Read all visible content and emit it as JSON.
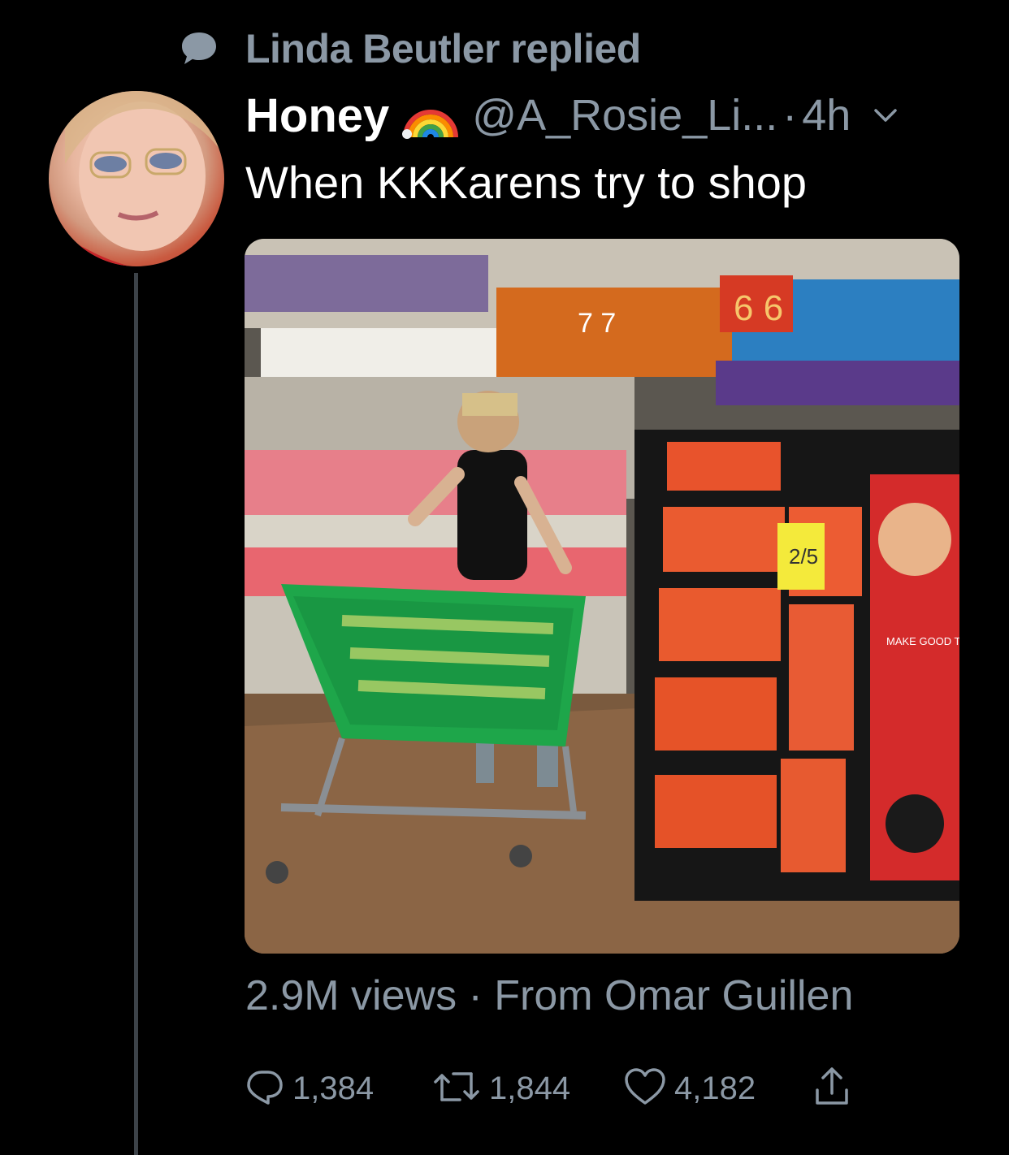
{
  "social_context": {
    "icon": "speech-bubble-icon",
    "text": "Linda Beutler replied"
  },
  "tweet": {
    "author_name": "Honey",
    "author_emoji": "rainbow-icon",
    "handle": "@A_Rosie_Li...",
    "separator": "·",
    "time": "4h",
    "text": "When KKKarens try to shop",
    "media_views": "2.9M views · From Omar Guillen"
  },
  "actions": {
    "reply_count": "1,384",
    "retweet_count": "1,844",
    "like_count": "4,182"
  },
  "media_printed_text": {
    "aisle_numbers": [
      "7 7",
      "6 6"
    ],
    "price_tag": "2/5",
    "banner": "MAKE GOOD TIMES BETTER"
  },
  "colors": {
    "background": "#000000",
    "secondary_text": "#8b98a5",
    "primary_text": "#ffffff",
    "thread_line": "#3d4349"
  }
}
